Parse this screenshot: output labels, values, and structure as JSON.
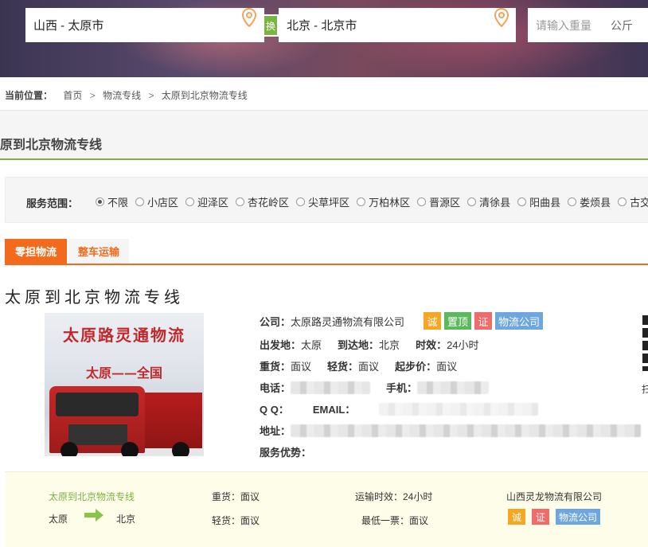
{
  "search": {
    "from": "山西 - 太原市",
    "swap": "换",
    "to": "北京 - 北京市",
    "weight_placeholder": "请输入重量",
    "weight_unit": "公斤"
  },
  "breadcrumb": {
    "label": "当前位置：",
    "items": [
      "首页",
      "物流专线",
      "太原到北京物流专线"
    ],
    "sep": ">"
  },
  "page_title": "原到北京物流专线",
  "service_range": {
    "label": "服务范围：",
    "options": [
      "不限",
      "小店区",
      "迎泽区",
      "杏花岭区",
      "尖草坪区",
      "万柏林区",
      "晋源区",
      "清徐县",
      "阳曲县",
      "娄烦县",
      "古交"
    ],
    "selected": "不限"
  },
  "tabs": [
    "零担物流",
    "整车运输"
  ],
  "line_title": "太原到北京物流专线",
  "logo": {
    "line1": "太原路灵通物流",
    "line2": "太原——全国"
  },
  "info": {
    "company_label": "公司：",
    "company": "太原路灵通物流有限公司",
    "badges": [
      "诚",
      "置顶",
      "证",
      "物流公司"
    ],
    "from_label": "出发地：",
    "from": "太原",
    "to_label": "到达地：",
    "to": "北京",
    "time_label": "时效：",
    "time": "24小时",
    "heavy_label": "重货：",
    "heavy": "面议",
    "light_label": "轻货：",
    "light": "面议",
    "min_label": "起步价：",
    "min": "面议",
    "phone_label": "电话：",
    "mobile_label": "手机：",
    "qq_label": "Q Q：",
    "email_label": "EMAIL：",
    "address_label": "地址：",
    "advantage_label": "服务优势："
  },
  "edge_char": "扫",
  "strip": {
    "title": "太原到北京物流专线",
    "from": "太原",
    "to": "北京",
    "heavy": "重货：面议",
    "light": "轻货：面议",
    "time": "运输时效：24小时",
    "min": "最低一票：面议",
    "company": "山西灵龙物流有限公司",
    "badges": [
      "诚",
      "证",
      "物流公司"
    ]
  },
  "colors": {
    "accent": "#f26b1d",
    "green": "#7cb342"
  }
}
